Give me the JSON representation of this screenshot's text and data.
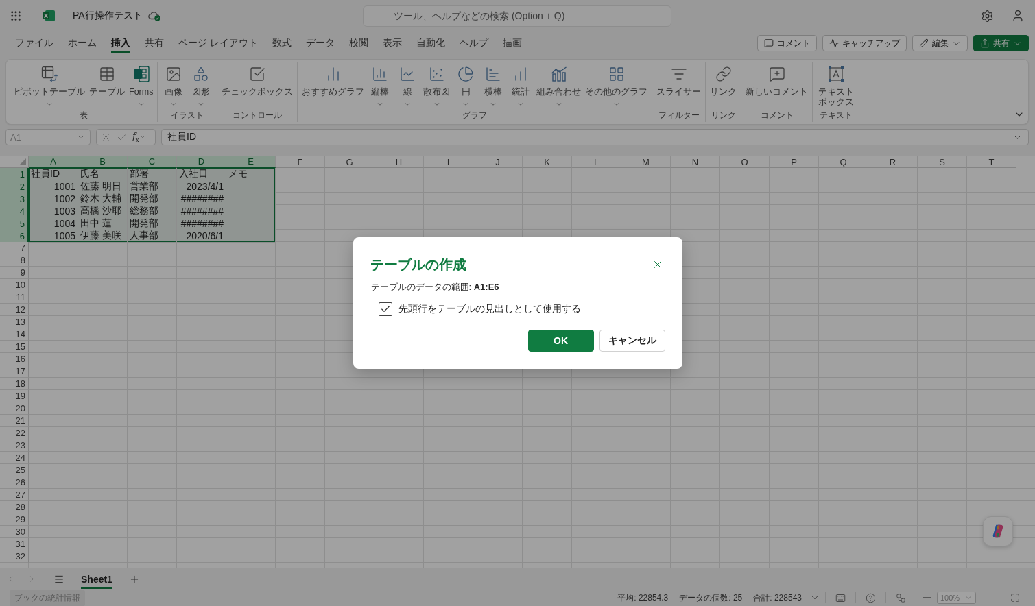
{
  "app_bar": {
    "title": "PA行操作テスト",
    "search": {
      "placeholder": "ツール、ヘルプなどの検索 (Option + Q)"
    }
  },
  "menu_tabs": [
    {
      "label": "ファイル",
      "selected": false
    },
    {
      "label": "ホーム",
      "selected": false
    },
    {
      "label": "挿入",
      "selected": true
    },
    {
      "label": "共有",
      "selected": false
    },
    {
      "label": "ページ レイアウト",
      "selected": false
    },
    {
      "label": "数式",
      "selected": false
    },
    {
      "label": "データ",
      "selected": false
    },
    {
      "label": "校閲",
      "selected": false
    },
    {
      "label": "表示",
      "selected": false
    },
    {
      "label": "自動化",
      "selected": false
    },
    {
      "label": "ヘルプ",
      "selected": false
    },
    {
      "label": "描画",
      "selected": false
    }
  ],
  "action_buttons": [
    {
      "label": "コメント",
      "kind": "outline",
      "dropdown": false
    },
    {
      "label": "キャッチアップ",
      "kind": "outline",
      "dropdown": false
    },
    {
      "label": "編集",
      "kind": "outline",
      "dropdown": true
    },
    {
      "label": "共有",
      "kind": "primary",
      "dropdown": true
    }
  ],
  "ribbon": {
    "groups": [
      {
        "label": "表",
        "items": [
          {
            "label": "ピボットテーブル",
            "dropdown": true
          },
          {
            "label": "テーブル",
            "dropdown": false
          },
          {
            "label": "Forms",
            "dropdown": true
          }
        ]
      },
      {
        "label": "イラスト",
        "items": [
          {
            "label": "画像",
            "dropdown": true
          },
          {
            "label": "図形",
            "dropdown": true
          }
        ]
      },
      {
        "label": "コントロール",
        "items": [
          {
            "label": "チェックボックス",
            "dropdown": false
          }
        ]
      },
      {
        "label": "グラフ",
        "items": [
          {
            "label": "おすすめグラフ",
            "dropdown": false
          },
          {
            "label": "縦棒",
            "dropdown": true
          },
          {
            "label": "線",
            "dropdown": true
          },
          {
            "label": "散布図",
            "dropdown": true
          },
          {
            "label": "円",
            "dropdown": true
          },
          {
            "label": "横棒",
            "dropdown": true
          },
          {
            "label": "統計",
            "dropdown": true
          },
          {
            "label": "組み合わせ",
            "dropdown": true
          },
          {
            "label": "その他のグラフ",
            "dropdown": true
          }
        ]
      },
      {
        "label": "フィルター",
        "items": [
          {
            "label": "スライサー",
            "dropdown": false
          }
        ]
      },
      {
        "label": "リンク",
        "items": [
          {
            "label": "リンク",
            "dropdown": false
          }
        ]
      },
      {
        "label": "コメント",
        "items": [
          {
            "label": "新しいコメント",
            "dropdown": false
          }
        ]
      },
      {
        "label": "テキスト",
        "items": [
          {
            "label": "テキストボックス",
            "dropdown": false
          }
        ]
      }
    ]
  },
  "formula_bar": {
    "name_box": {
      "value": "A1",
      "disabled": true
    },
    "function_button": "*f*$_{x}$",
    "formula": "社員ID"
  },
  "sheet": {
    "columns": [
      {
        "label": "A",
        "selected": true
      },
      {
        "label": "B",
        "selected": true
      },
      {
        "label": "C",
        "selected": true
      },
      {
        "label": "D",
        "selected": true
      },
      {
        "label": "E",
        "selected": true
      },
      {
        "label": "F",
        "selected": false
      },
      {
        "label": "G",
        "selected": false
      },
      {
        "label": "H",
        "selected": false
      },
      {
        "label": "I",
        "selected": false
      },
      {
        "label": "J",
        "selected": false
      },
      {
        "label": "K",
        "selected": false
      },
      {
        "label": "L",
        "selected": false
      },
      {
        "label": "M",
        "selected": false
      },
      {
        "label": "N",
        "selected": false
      },
      {
        "label": "O",
        "selected": false
      },
      {
        "label": "P",
        "selected": false
      },
      {
        "label": "Q",
        "selected": false
      },
      {
        "label": "R",
        "selected": false
      },
      {
        "label": "S",
        "selected": false
      },
      {
        "label": "T",
        "selected": false
      }
    ],
    "rows": [
      {
        "label": "1",
        "selected": true,
        "cells": [
          {
            "text": "社員ID",
            "kind": "text"
          },
          {
            "text": "氏名",
            "kind": "text"
          },
          {
            "text": "部署",
            "kind": "text"
          },
          {
            "text": "入社日",
            "kind": "text"
          },
          {
            "text": "メモ",
            "kind": "text"
          }
        ]
      },
      {
        "label": "2",
        "selected": true,
        "cells": [
          {
            "text": "1001",
            "kind": "number"
          },
          {
            "text": "佐藤 明日",
            "kind": "text"
          },
          {
            "text": "営業部",
            "kind": "text"
          },
          {
            "text": "2023/4/1",
            "kind": "number"
          }
        ]
      },
      {
        "label": "3",
        "selected": true,
        "cells": [
          {
            "text": "1002",
            "kind": "number"
          },
          {
            "text": "鈴木 大輔",
            "kind": "text"
          },
          {
            "text": "開発部",
            "kind": "text"
          },
          {
            "text": "########",
            "kind": "number"
          }
        ]
      },
      {
        "label": "4",
        "selected": true,
        "cells": [
          {
            "text": "1003",
            "kind": "number"
          },
          {
            "text": "高橋 沙耶",
            "kind": "text"
          },
          {
            "text": "総務部",
            "kind": "text"
          },
          {
            "text": "########",
            "kind": "number"
          }
        ]
      },
      {
        "label": "5",
        "selected": true,
        "cells": [
          {
            "text": "1004",
            "kind": "number"
          },
          {
            "text": "田中 蓮",
            "kind": "text"
          },
          {
            "text": "開発部",
            "kind": "text"
          },
          {
            "text": "########",
            "kind": "number"
          }
        ]
      },
      {
        "label": "6",
        "selected": true,
        "cells": [
          {
            "text": "1005",
            "kind": "number"
          },
          {
            "text": "伊藤 美咲",
            "kind": "text"
          },
          {
            "text": "人事部",
            "kind": "text"
          },
          {
            "text": "2020/6/1",
            "kind": "number"
          }
        ]
      },
      {
        "label": "7",
        "selected": false
      },
      {
        "label": "8",
        "selected": false
      },
      {
        "label": "9",
        "selected": false
      },
      {
        "label": "10",
        "selected": false
      },
      {
        "label": "11",
        "selected": false
      },
      {
        "label": "12",
        "selected": false
      },
      {
        "label": "13",
        "selected": false
      },
      {
        "label": "14",
        "selected": false
      },
      {
        "label": "15",
        "selected": false
      },
      {
        "label": "16",
        "selected": false
      },
      {
        "label": "17",
        "selected": false
      },
      {
        "label": "18",
        "selected": false
      },
      {
        "label": "19",
        "selected": false
      },
      {
        "label": "20",
        "selected": false
      },
      {
        "label": "21",
        "selected": false
      },
      {
        "label": "22",
        "selected": false
      },
      {
        "label": "23",
        "selected": false
      },
      {
        "label": "24",
        "selected": false
      },
      {
        "label": "25",
        "selected": false
      },
      {
        "label": "26",
        "selected": false
      },
      {
        "label": "27",
        "selected": false
      },
      {
        "label": "28",
        "selected": false
      },
      {
        "label": "29",
        "selected": false
      },
      {
        "label": "30",
        "selected": false
      },
      {
        "label": "31",
        "selected": false
      },
      {
        "label": "32",
        "selected": false
      }
    ]
  },
  "sheet_tabs": [
    {
      "label": "Sheet1",
      "selected": true
    }
  ],
  "status_bar": {
    "workbook_stats": {
      "label": "ブックの統計情報",
      "disabled": true
    },
    "stats": [
      "平均: 22854.3",
      "データの個数: 25",
      "合計: 228543"
    ],
    "zoom": {
      "value": "100%",
      "disabled": true
    }
  },
  "dialog": {
    "title": "テーブルの作成",
    "range_text": "テーブルのデータの範囲: **A1:E6**",
    "header_checkbox": {
      "label": "先頭行をテーブルの見出しとして使用する",
      "checked": true
    },
    "buttons": [
      {
        "label": "OK",
        "kind": "primary"
      },
      {
        "label": "キャンセル",
        "kind": "secondary"
      }
    ]
  }
}
